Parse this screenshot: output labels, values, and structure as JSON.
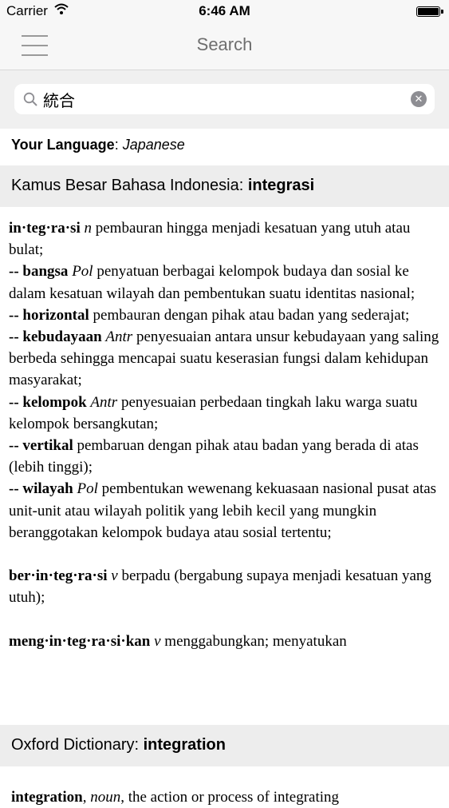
{
  "status_bar": {
    "carrier": "Carrier",
    "time": "6:46 AM",
    "battery_level": 1.0
  },
  "nav": {
    "title": "Search",
    "menu_icon": "hamburger-icon"
  },
  "search": {
    "value": "統合",
    "icon": "search-icon",
    "clear_icon": "clear-icon"
  },
  "language": {
    "label": "Your Language",
    "separator": ": ",
    "value": "Japanese"
  },
  "kbbi": {
    "header_prefix": "Kamus Besar Bahasa Indonesia: ",
    "header_term": "integrasi",
    "entries": [
      {
        "head": "in·teg·ra·si",
        "pos": "n",
        "text": "pembauran hingga menjadi kesatuan yang utuh atau bulat;"
      },
      {
        "head": "-- bangsa",
        "pos": "Pol",
        "text": "penyatuan berbagai kelompok budaya dan sosial ke dalam kesatuan wilayah dan pembentukan suatu identitas nasional;"
      },
      {
        "head": "-- horizontal",
        "pos": "",
        "text": "pembauran dengan pihak atau badan yang sederajat;"
      },
      {
        "head": "-- kebudayaan",
        "pos": "Antr",
        "text": "penyesuaian antara unsur kebudayaan yang saling berbeda sehingga mencapai suatu keserasian fungsi dalam kehidupan masyarakat;"
      },
      {
        "head": "-- kelompok",
        "pos": "Antr",
        "text": "penyesuaian perbedaan tingkah laku warga suatu kelompok bersangkutan;"
      },
      {
        "head": "-- vertikal",
        "pos": "",
        "text": "pembaruan dengan pihak atau badan yang berada di atas (lebih tinggi);"
      },
      {
        "head": "-- wilayah",
        "pos": "Pol",
        "text": "pembentukan wewenang kekuasaan nasional pusat atas unit-unit atau wilayah politik yang lebih kecil yang mungkin beranggotakan kelompok budaya atau sosial tertentu;"
      }
    ],
    "derived": [
      {
        "head": "ber·in·teg·ra·si",
        "pos": "v",
        "text": "berpadu (bergabung supaya menjadi kesatuan yang utuh);"
      },
      {
        "head": "meng·in·teg·ra·si·kan",
        "pos": "v",
        "text": "menggabungkan; menyatukan"
      }
    ]
  },
  "oxford": {
    "header_prefix": "Oxford Dictionary: ",
    "header_term": "integration",
    "entry": {
      "head": "integration",
      "pos": "noun",
      "text": "the action or process of integrating"
    }
  }
}
